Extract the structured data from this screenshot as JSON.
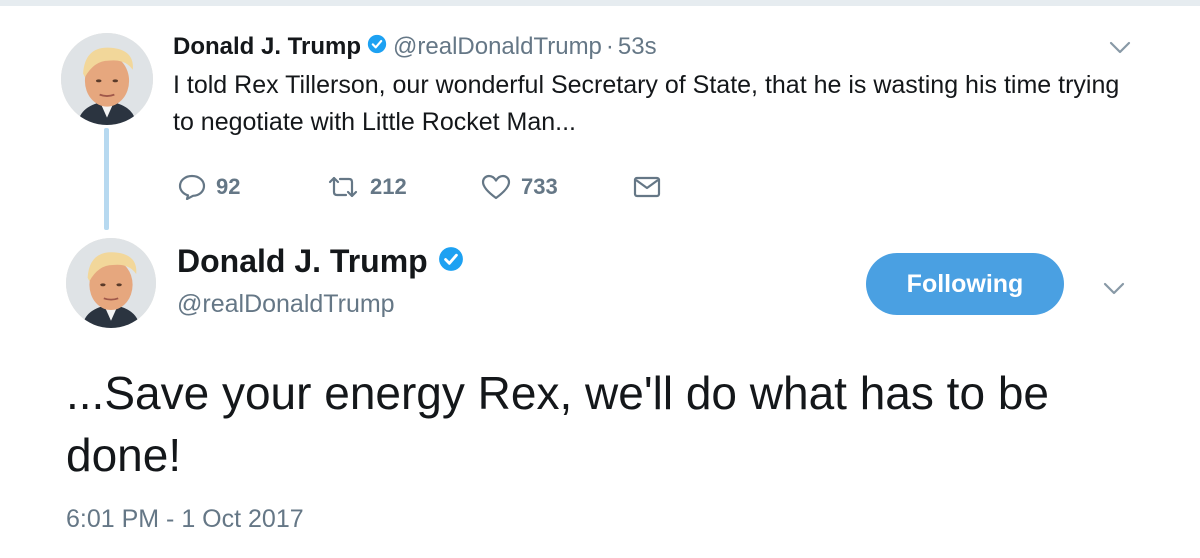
{
  "parent_tweet": {
    "name": "Donald J. Trump",
    "handle": "@realDonaldTrump",
    "separator": "·",
    "time": "53s",
    "text": "I told Rex Tillerson, our wonderful Secretary of State, that he is wasting his time trying to negotiate with Little Rocket Man...",
    "replies": "92",
    "retweets": "212",
    "likes": "733"
  },
  "main_tweet": {
    "name": "Donald J. Trump",
    "handle": "@realDonaldTrump",
    "follow_label": "Following",
    "text": "...Save your energy Rex, we'll do what has to be done!",
    "timestamp": "6:01 PM - 1 Oct 2017"
  },
  "icons": {
    "verified": "verified-badge-icon",
    "reply": "reply-icon",
    "retweet": "retweet-icon",
    "like": "heart-icon",
    "message": "envelope-icon",
    "more": "chevron-down-icon"
  },
  "colors": {
    "accent": "#4aa0e2",
    "verified": "#1da1f2",
    "secondary_text": "#657786",
    "thread_line": "#b7d9f0"
  }
}
